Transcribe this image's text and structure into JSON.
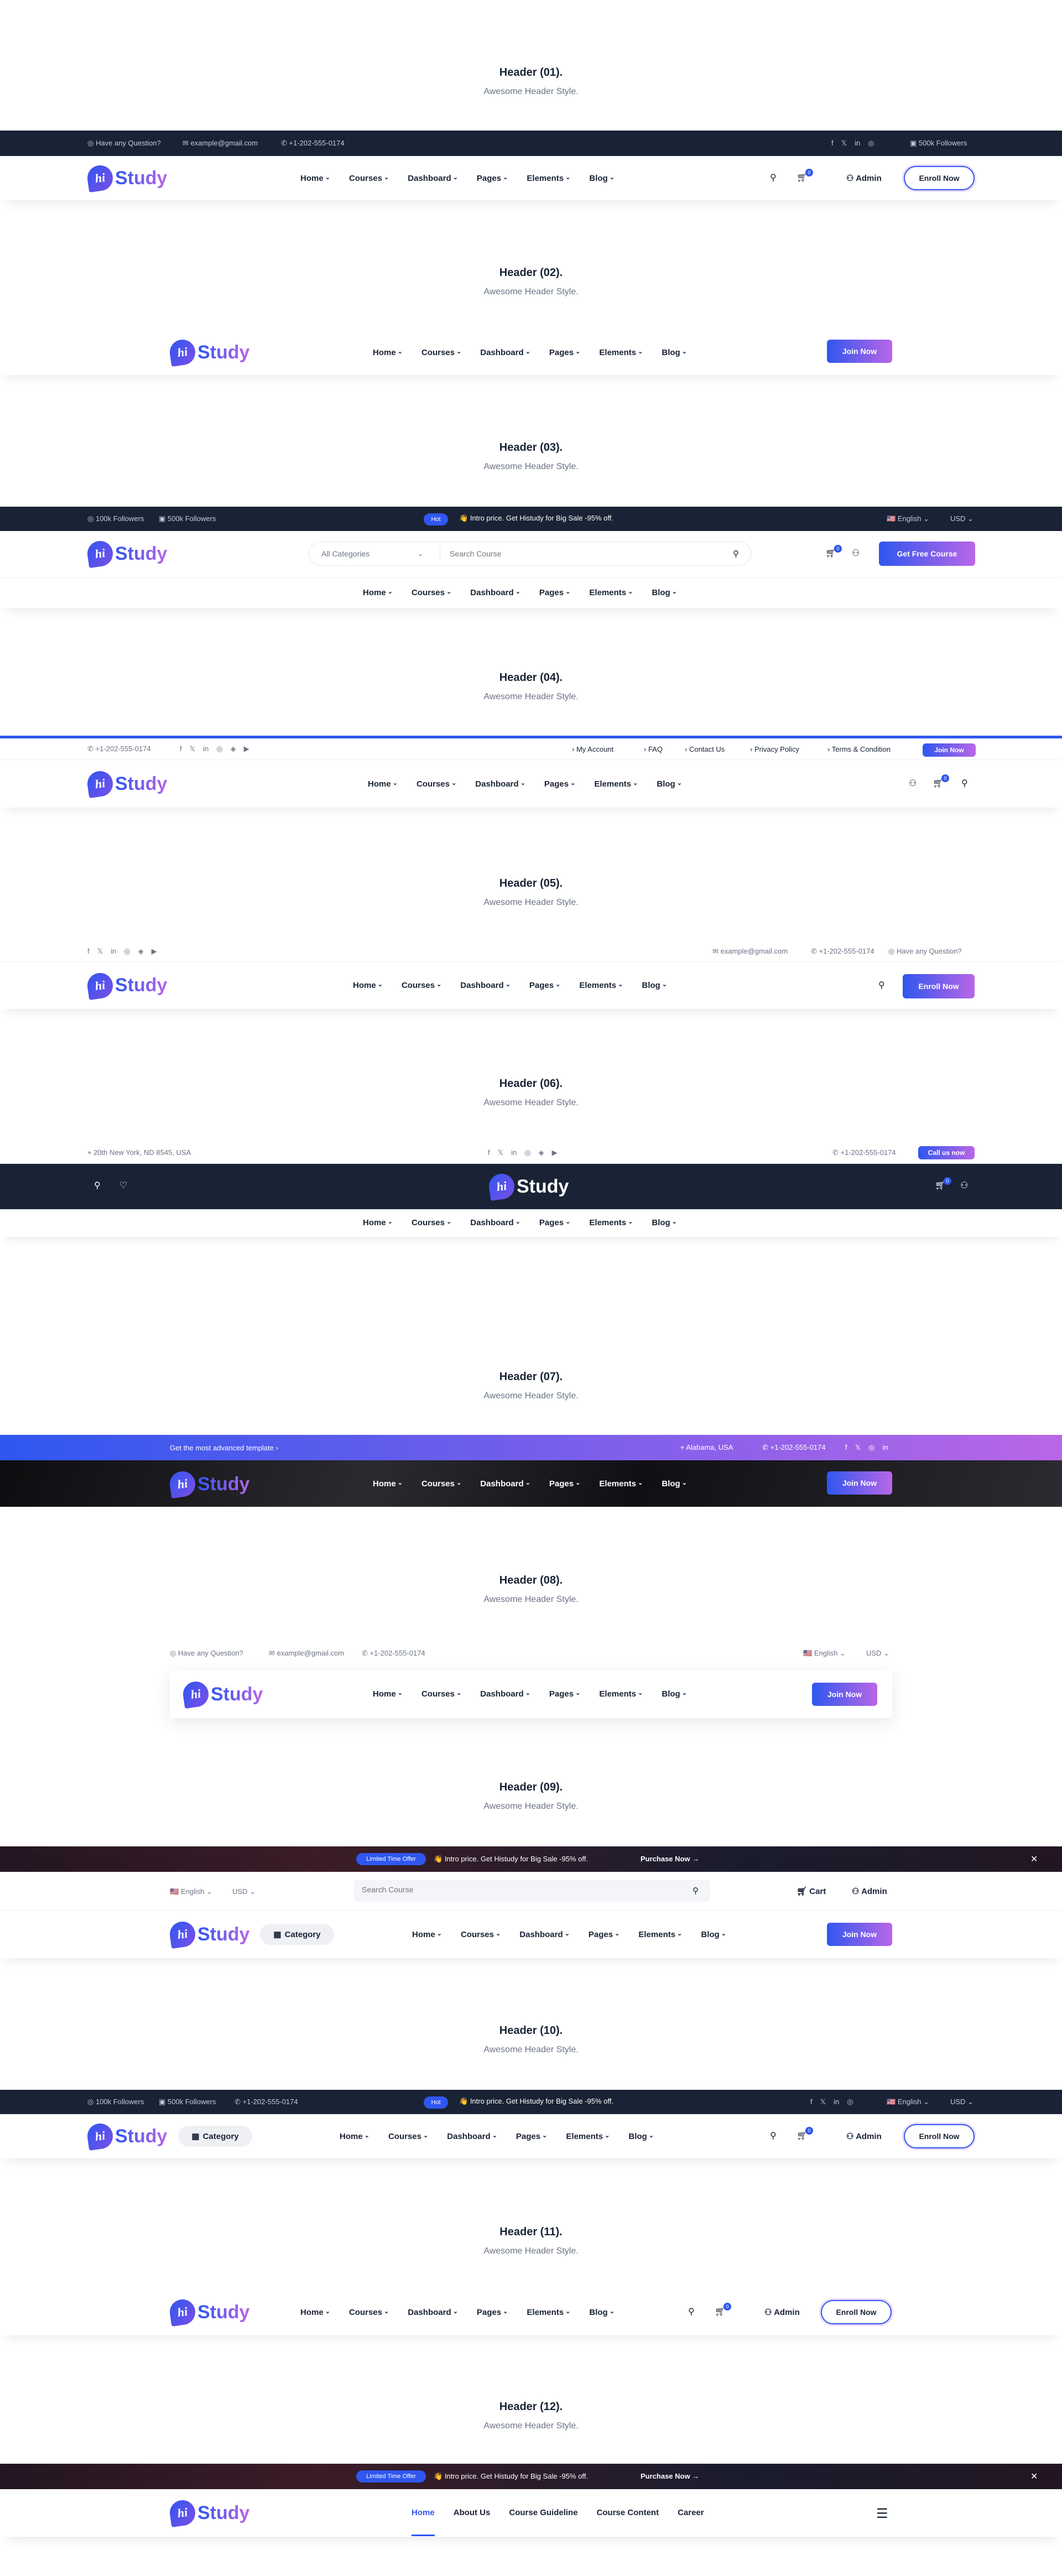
{
  "sections": [
    {
      "title": "Header (01).",
      "subtitle": "Awesome Header Style."
    },
    {
      "title": "Header (02).",
      "subtitle": "Awesome Header Style."
    },
    {
      "title": "Header (03).",
      "subtitle": "Awesome Header Style."
    },
    {
      "title": "Header (04).",
      "subtitle": "Awesome Header Style."
    },
    {
      "title": "Header (05).",
      "subtitle": "Awesome Header Style."
    },
    {
      "title": "Header (06).",
      "subtitle": "Awesome Header Style."
    },
    {
      "title": "Header (07).",
      "subtitle": "Awesome Header Style."
    },
    {
      "title": "Header (08).",
      "subtitle": "Awesome Header Style."
    },
    {
      "title": "Header (09).",
      "subtitle": "Awesome Header Style."
    },
    {
      "title": "Header (10).",
      "subtitle": "Awesome Header Style."
    },
    {
      "title": "Header (11).",
      "subtitle": "Awesome Header Style."
    },
    {
      "title": "Header (12).",
      "subtitle": "Awesome Header Style."
    }
  ],
  "brand": {
    "mark": "hi",
    "name": "Study"
  },
  "menu": [
    "Home",
    "Courses",
    "Dashboard",
    "Pages",
    "Elements",
    "Blog"
  ],
  "top": {
    "question": "Have any Question?",
    "email": "example@gmail.com",
    "phone": "+1-202-555-0174",
    "followers_insta": "100k Followers",
    "followers_fb": "500k Followers",
    "hot": "Hot",
    "intro": "Intro price. Get Histudy for Big Sale -95% off.",
    "lang": "English",
    "currency": "USD",
    "my_account": "My Account",
    "faq": "FAQ",
    "contact": "Contact Us",
    "privacy": "Privacy Policy",
    "terms": "Terms & Condition",
    "join_now": "Join Now",
    "address": "20th New York, ND 8545, USA",
    "call_now": "Call us now",
    "advanced": "Get the most advanced template",
    "location": "Alabama, USA",
    "limited": "Limited Time Offer",
    "purchase": "Purchase Now"
  },
  "buttons": {
    "admin": "Admin",
    "enroll": "Enroll Now",
    "join": "Join Now",
    "free_course": "Get Free Course",
    "category": "Category",
    "cart": "Cart"
  },
  "search": {
    "categories": "All Categories",
    "placeholder": "Search Course"
  },
  "cart_count": "0",
  "menu12": [
    "Home",
    "About Us",
    "Course Guideline",
    "Course Content",
    "Career"
  ],
  "colors": {
    "primary": "#2f57ef",
    "secondary": "#b966e7",
    "dark": "#192335"
  }
}
